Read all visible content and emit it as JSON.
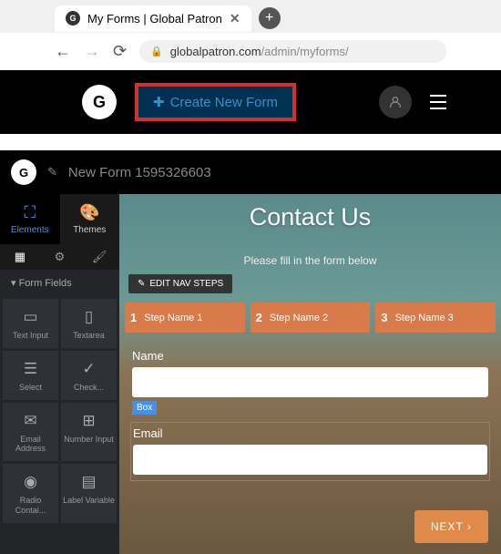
{
  "browser": {
    "tab_title": "My Forms | Global Patron",
    "url_domain": "globalpatron.com",
    "url_path": "/admin/myforms/"
  },
  "header": {
    "create_label": "Create New Form"
  },
  "editor": {
    "form_name": "New Form 1595326603",
    "sidebar": {
      "tab_elements": "Elements",
      "tab_themes": "Themes",
      "fields_label": "Form Fields",
      "tiles": [
        {
          "label": "Text Input"
        },
        {
          "label": "Textarea"
        },
        {
          "label": "Select"
        },
        {
          "label": "Check..."
        },
        {
          "label": "Email Address"
        },
        {
          "label": "Number Input"
        },
        {
          "label": "Radio Contai..."
        },
        {
          "label": "Label Variable"
        }
      ]
    },
    "canvas": {
      "title": "Contact Us",
      "subtitle": "Please fill in the form below",
      "edit_nav": "EDIT NAV STEPS",
      "steps": [
        {
          "num": "1",
          "name": "Step Name 1"
        },
        {
          "num": "2",
          "name": "Step Name 2"
        },
        {
          "num": "3",
          "name": "Step Name 3"
        }
      ],
      "name_label": "Name",
      "box_badge": "Box",
      "email_label": "Email",
      "next_label": "NEXT"
    }
  }
}
